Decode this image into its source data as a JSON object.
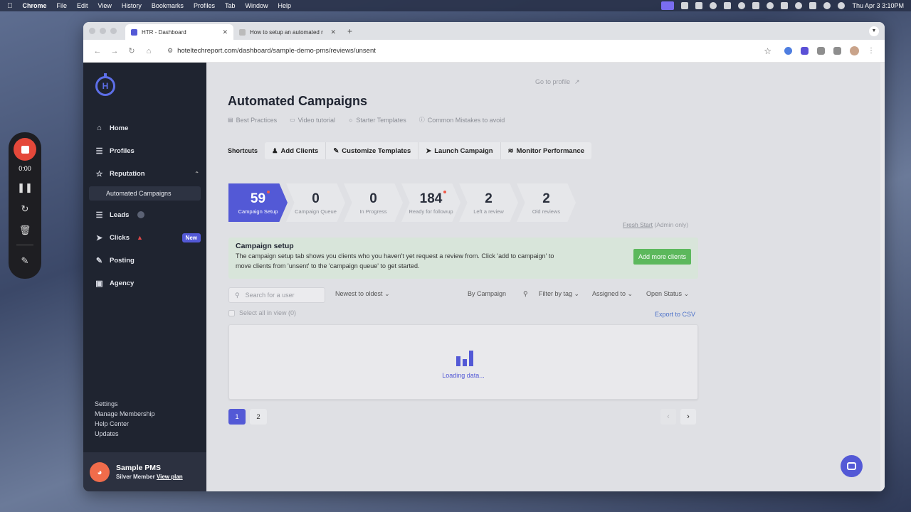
{
  "menubar": {
    "app": "Chrome",
    "items": [
      "File",
      "Edit",
      "View",
      "History",
      "Bookmarks",
      "Profiles",
      "Tab",
      "Window",
      "Help"
    ],
    "datetime": "Thu Apr 3  3:10PM"
  },
  "recorder": {
    "time": "0:00"
  },
  "browser": {
    "tabs": [
      {
        "title": "HTR - Dashboard",
        "active": true
      },
      {
        "title": "How to setup an automated r",
        "active": false
      }
    ],
    "url": "hoteltechreport.com/dashboard/sample-demo-pms/reviews/unsent"
  },
  "sidebar": {
    "logo_text": "H",
    "items": [
      {
        "label": "Home",
        "icon": "home-icon"
      },
      {
        "label": "Profiles",
        "icon": "layers-icon"
      },
      {
        "label": "Reputation",
        "icon": "star-icon"
      },
      {
        "label": "Leads",
        "icon": "leads-icon"
      },
      {
        "label": "Clicks",
        "icon": "cursor-icon"
      },
      {
        "label": "Posting",
        "icon": "edit-icon"
      },
      {
        "label": "Agency",
        "icon": "ad-icon"
      }
    ],
    "subitem": "Automated Campaigns",
    "clicks_badge": "New",
    "links": [
      "Settings",
      "Manage Membership",
      "Help Center",
      "Updates"
    ],
    "account": {
      "name": "Sample PMS",
      "tier": "Silver Member",
      "view_plan": "View plan"
    }
  },
  "main": {
    "go_to_profile": "Go to profile",
    "title": "Automated Campaigns",
    "guides": [
      "Best Practices",
      "Video tutorial",
      "Starter Templates",
      "Common Mistakes to avoid"
    ],
    "shortcuts_label": "Shortcuts",
    "shortcuts": [
      "Add Clients",
      "Customize Templates",
      "Launch Campaign",
      "Monitor Performance"
    ],
    "steps": [
      {
        "count": "59",
        "label": "Campaign Setup",
        "active": true,
        "dot": true
      },
      {
        "count": "0",
        "label": "Campaign Queue",
        "active": false,
        "dot": false
      },
      {
        "count": "0",
        "label": "In Progress",
        "active": false,
        "dot": false
      },
      {
        "count": "184",
        "label": "Ready for followup",
        "active": false,
        "dot": true
      },
      {
        "count": "2",
        "label": "Left a review",
        "active": false,
        "dot": false
      },
      {
        "count": "2",
        "label": "Old reviews",
        "active": false,
        "dot": false
      }
    ],
    "fresh_start": "Fresh Start",
    "fresh_start_note": "(Admin only)",
    "setup": {
      "title": "Campaign setup",
      "desc": "The campaign setup tab shows you clients who you haven't yet request a review from. Click 'add to campaign' to move clients from 'unsent' to the 'campaign queue' to get started.",
      "button": "Add more clients"
    },
    "search_placeholder": "Search for a user",
    "sort": "Newest to oldest",
    "by_campaign": "By Campaign",
    "filter_tag": "Filter by tag",
    "assigned_to": "Assigned to",
    "open_status": "Open Status",
    "select_all": "Select all in view (0)",
    "export": "Export to CSV",
    "loading": "Loading data...",
    "pages": [
      "1",
      "2"
    ],
    "current_page": "1"
  },
  "colors": {
    "accent": "#5359d6",
    "sidebar_bg": "#1f2430",
    "success": "#5cb85c",
    "setup_bg": "#d8e5da"
  }
}
